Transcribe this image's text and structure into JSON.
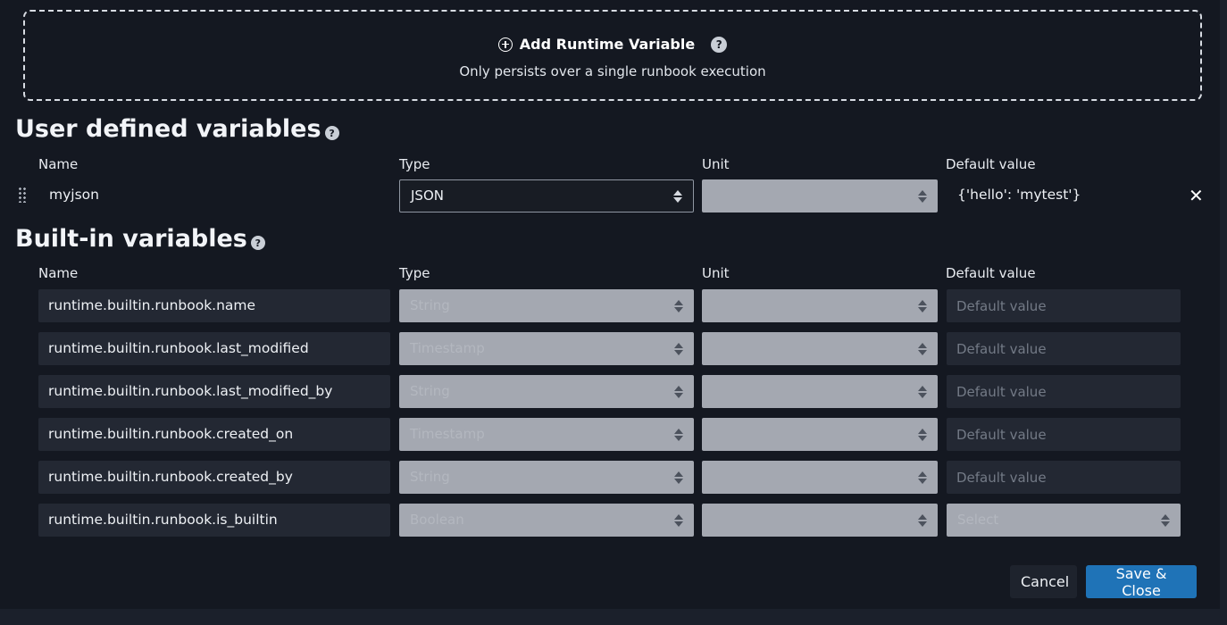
{
  "add_runtime": {
    "title": "Add Runtime Variable",
    "subtitle": "Only persists over a single runbook execution"
  },
  "user_section": {
    "title": "User defined variables",
    "headers": {
      "name": "Name",
      "type": "Type",
      "unit": "Unit",
      "default": "Default value"
    },
    "rows": [
      {
        "name": "myjson",
        "type": "JSON",
        "unit": "",
        "default": "{'hello': 'mytest'}"
      }
    ]
  },
  "builtin_section": {
    "title": "Built-in variables",
    "headers": {
      "name": "Name",
      "type": "Type",
      "unit": "Unit",
      "default": "Default value"
    },
    "default_placeholder": "Default value",
    "select_placeholder": "Select",
    "rows": [
      {
        "name": "runtime.builtin.runbook.name",
        "type": "String"
      },
      {
        "name": "runtime.builtin.runbook.last_modified",
        "type": "Timestamp"
      },
      {
        "name": "runtime.builtin.runbook.last_modified_by",
        "type": "String"
      },
      {
        "name": "runtime.builtin.runbook.created_on",
        "type": "Timestamp"
      },
      {
        "name": "runtime.builtin.runbook.created_by",
        "type": "String"
      },
      {
        "name": "runtime.builtin.runbook.is_builtin",
        "type": "Boolean"
      }
    ]
  },
  "footer": {
    "cancel": "Cancel",
    "save": "Save & Close"
  },
  "colors": {
    "accent": "#1f73b7",
    "background": "#141821",
    "field": "#232833",
    "disabled_select": "#a4a8b1"
  }
}
